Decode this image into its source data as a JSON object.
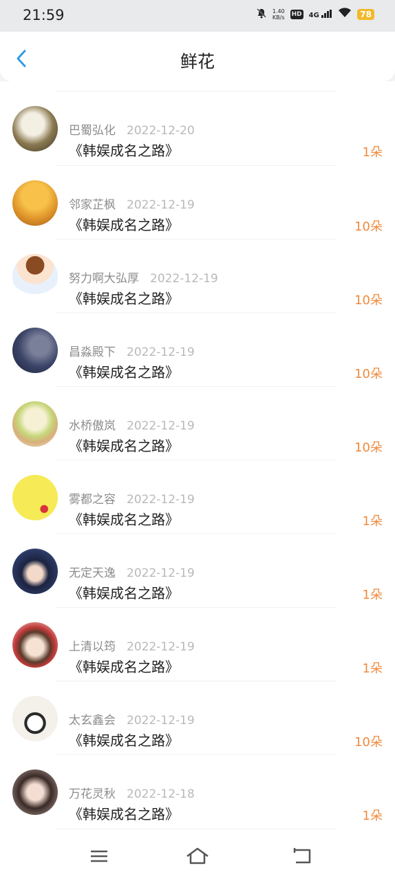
{
  "status_bar": {
    "time": "21:59",
    "net_speed": "1.40",
    "net_unit": "KB/s",
    "hd": "HD",
    "network": "4G",
    "battery": "78"
  },
  "header": {
    "title": "鲜花"
  },
  "items": [
    {
      "name": "巴蜀弘化",
      "date": "2022-12-20",
      "book": "《韩娱成名之路》",
      "count": "1朵"
    },
    {
      "name": "邻家芷枫",
      "date": "2022-12-19",
      "book": "《韩娱成名之路》",
      "count": "10朵"
    },
    {
      "name": "努力啊大弘厚",
      "date": "2022-12-19",
      "book": "《韩娱成名之路》",
      "count": "10朵"
    },
    {
      "name": "昌淼殿下",
      "date": "2022-12-19",
      "book": "《韩娱成名之路》",
      "count": "10朵"
    },
    {
      "name": "水桥傲岚",
      "date": "2022-12-19",
      "book": "《韩娱成名之路》",
      "count": "10朵"
    },
    {
      "name": "雾都之容",
      "date": "2022-12-19",
      "book": "《韩娱成名之路》",
      "count": "1朵"
    },
    {
      "name": "无定天逸",
      "date": "2022-12-19",
      "book": "《韩娱成名之路》",
      "count": "1朵"
    },
    {
      "name": "上清以筠",
      "date": "2022-12-19",
      "book": "《韩娱成名之路》",
      "count": "1朵"
    },
    {
      "name": "太玄鑫会",
      "date": "2022-12-19",
      "book": "《韩娱成名之路》",
      "count": "10朵"
    },
    {
      "name": "万花灵秋",
      "date": "2022-12-18",
      "book": "《韩娱成名之路》",
      "count": "1朵"
    }
  ],
  "colors": {
    "accent": "#2f9be6",
    "count": "#ef8a3e",
    "name": "#8c8c8c",
    "date": "#b9b9b9"
  },
  "icons": {
    "back": "chevron-left-icon",
    "menu": "menu-icon",
    "home": "home-icon",
    "return": "return-icon"
  }
}
